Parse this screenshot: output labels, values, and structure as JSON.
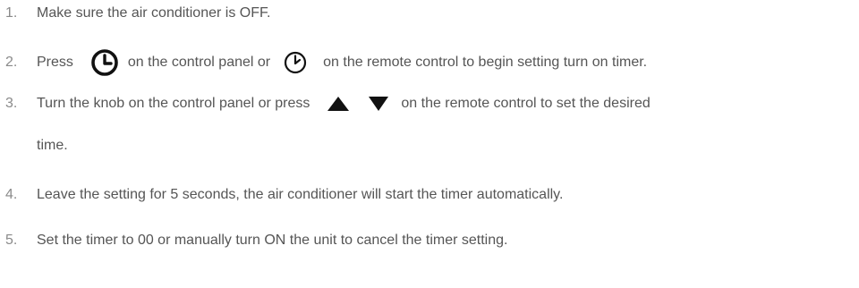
{
  "steps": [
    {
      "number": "1.",
      "text": "Make sure the air conditioner is OFF."
    },
    {
      "number": "2.",
      "part1": "Press",
      "icon1": "clock-bold-icon",
      "part2": "on the control panel or",
      "icon2": "clock-outline-icon",
      "part3": "on the remote control to begin setting turn on timer."
    },
    {
      "number": "3.",
      "part1": "Turn the knob on the control panel or press",
      "icon1": "triangle-up-icon",
      "icon2": "triangle-down-icon",
      "part2": "on the remote control to set the desired",
      "continuation": "time."
    },
    {
      "number": "4.",
      "text": "Leave the setting for 5 seconds, the air conditioner will start the timer automatically."
    },
    {
      "number": "5.",
      "text": "Set the timer to 00 or manually turn ON the unit to cancel the timer setting."
    }
  ],
  "colors": {
    "text": "#555555",
    "number": "#8a8a8a",
    "icon": "#111111"
  }
}
